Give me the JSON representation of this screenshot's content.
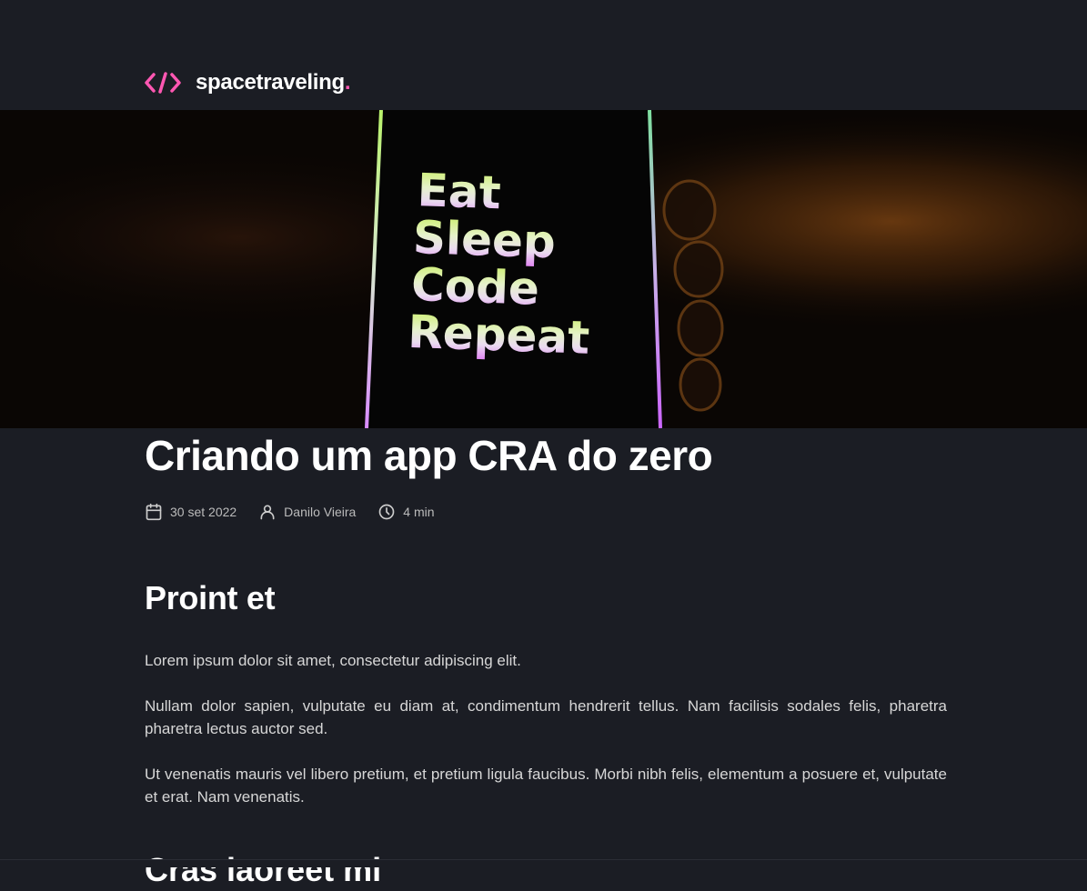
{
  "header": {
    "brand": "spacetraveling",
    "brand_dot": ".",
    "logo_icon": "code-brackets-icon",
    "accent_color": "#ff57b2"
  },
  "banner": {
    "lines": [
      "Eat",
      "Sleep",
      "Code",
      "Repeat"
    ]
  },
  "post": {
    "title": "Criando um app CRA do zero",
    "meta": {
      "date": "30 set 2022",
      "author": "Danilo Vieira",
      "reading_time": "4 min",
      "date_icon": "calendar-icon",
      "author_icon": "user-icon",
      "time_icon": "clock-icon"
    },
    "sections": [
      {
        "heading": "Proint et",
        "paragraphs": [
          "Lorem ipsum dolor sit amet, consectetur adipiscing elit.",
          "Nullam dolor sapien, vulputate eu diam at, condimentum hendrerit tellus. Nam facilisis sodales felis, pharetra pharetra lectus auctor sed.",
          "Ut venenatis mauris vel libero pretium, et pretium ligula faucibus. Morbi nibh felis, elementum a posuere et, vulputate et erat. Nam venenatis."
        ]
      },
      {
        "heading": "Cras laoreet mi"
      }
    ]
  }
}
